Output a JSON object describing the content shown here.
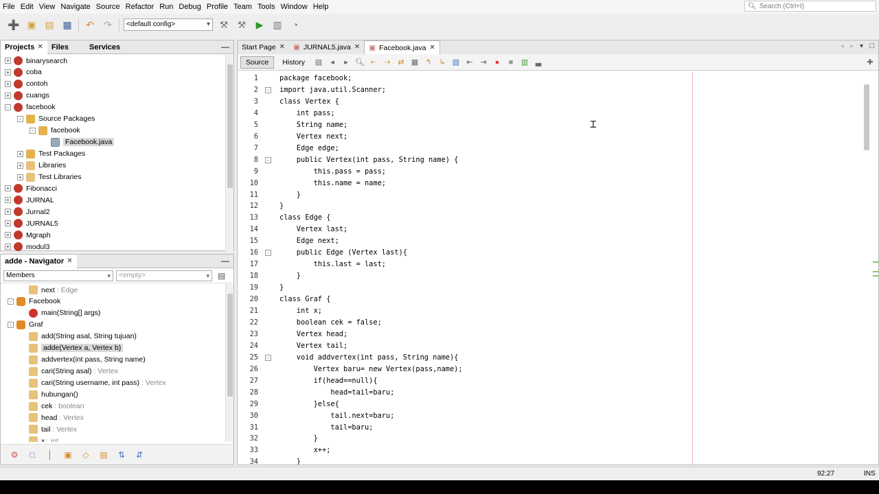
{
  "menubar": {
    "items": [
      "File",
      "Edit",
      "View",
      "Navigate",
      "Source",
      "Refactor",
      "Run",
      "Debug",
      "Profile",
      "Team",
      "Tools",
      "Window",
      "Help"
    ],
    "search_placeholder": "Search (Ctrl+I)"
  },
  "toolbar": {
    "config": "<default config>"
  },
  "projects_panel": {
    "tabs": [
      "Projects",
      "Files",
      "Services"
    ],
    "items": [
      {
        "label": "binarysearch",
        "level": 0,
        "type": "project",
        "expander": "+"
      },
      {
        "label": "coba",
        "level": 0,
        "type": "project",
        "expander": "+"
      },
      {
        "label": "contoh",
        "level": 0,
        "type": "project",
        "expander": "+"
      },
      {
        "label": "cuangs",
        "level": 0,
        "type": "project",
        "expander": "+"
      },
      {
        "label": "facebook",
        "level": 0,
        "type": "project",
        "expander": "-"
      },
      {
        "label": "Source Packages",
        "level": 1,
        "type": "pkg",
        "expander": "-"
      },
      {
        "label": "facebook",
        "level": 2,
        "type": "pkg",
        "expander": "-"
      },
      {
        "label": "Facebook.java",
        "level": 3,
        "type": "file",
        "expander": "",
        "selected": true
      },
      {
        "label": "Test Packages",
        "level": 1,
        "type": "pkg",
        "expander": "+"
      },
      {
        "label": "Libraries",
        "level": 1,
        "type": "lib",
        "expander": "+"
      },
      {
        "label": "Test Libraries",
        "level": 1,
        "type": "lib",
        "expander": "+"
      },
      {
        "label": "Fibonacci",
        "level": 0,
        "type": "project",
        "expander": "+"
      },
      {
        "label": "JURNAL",
        "level": 0,
        "type": "project",
        "expander": "+"
      },
      {
        "label": "Jurnal2",
        "level": 0,
        "type": "project",
        "expander": "+"
      },
      {
        "label": "JURNAL5",
        "level": 0,
        "type": "project",
        "expander": "+"
      },
      {
        "label": "Mgraph",
        "level": 0,
        "type": "project",
        "expander": "+"
      },
      {
        "label": "modul3",
        "level": 0,
        "type": "project",
        "expander": "+"
      }
    ]
  },
  "navigator_panel": {
    "title": "adde - Navigator",
    "filter_members": "Members",
    "filter_empty": "<empty>",
    "items": [
      {
        "label": "next",
        "type_suffix": " : Edge",
        "level": 2,
        "type": "field"
      },
      {
        "label": "Facebook",
        "type_suffix": "",
        "level": 1,
        "type": "class",
        "expander": "-"
      },
      {
        "label": "main(String[] args)",
        "type_suffix": "",
        "level": 2,
        "type": "method"
      },
      {
        "label": "Graf",
        "type_suffix": "",
        "level": 1,
        "type": "class",
        "expander": "-"
      },
      {
        "label": "add(String asal, String tujuan)",
        "type_suffix": "",
        "level": 2,
        "type": "field"
      },
      {
        "label": "adde(Vertex a, Vertex b)",
        "type_suffix": "",
        "level": 2,
        "type": "field",
        "selected": true
      },
      {
        "label": "addvertex(int pass, String name)",
        "type_suffix": "",
        "level": 2,
        "type": "field"
      },
      {
        "label": "cari(String asal)",
        "type_suffix": " : Vertex",
        "level": 2,
        "type": "field"
      },
      {
        "label": "cari(String username, int pass)",
        "type_suffix": " : Vertex",
        "level": 2,
        "type": "field"
      },
      {
        "label": "hubungan()",
        "type_suffix": "",
        "level": 2,
        "type": "field"
      },
      {
        "label": "cek",
        "type_suffix": " : boolean",
        "level": 2,
        "type": "field"
      },
      {
        "label": "head",
        "type_suffix": " : Vertex",
        "level": 2,
        "type": "field"
      },
      {
        "label": "tail",
        "type_suffix": " : Vertex",
        "level": 2,
        "type": "field"
      },
      {
        "label": "x",
        "type_suffix": " : int",
        "level": 2,
        "type": "field"
      }
    ]
  },
  "editor": {
    "tabs": [
      "Start Page",
      "JURNAL5.java",
      "Facebook.java"
    ],
    "active_tab": "Facebook.java",
    "source_label": "Source",
    "history_label": "History",
    "lines": [
      {
        "n": "1",
        "text": "package facebook;",
        "fold": ""
      },
      {
        "n": "2",
        "text": "import java.util.Scanner;",
        "fold": "-"
      },
      {
        "n": "3",
        "text": "class Vertex {",
        "fold": ""
      },
      {
        "n": "4",
        "text": "    int pass;",
        "fold": ""
      },
      {
        "n": "5",
        "text": "    String name;",
        "fold": ""
      },
      {
        "n": "6",
        "text": "    Vertex next;",
        "fold": ""
      },
      {
        "n": "7",
        "text": "    Edge edge;",
        "fold": ""
      },
      {
        "n": "8",
        "text": "    public Vertex(int pass, String name) {",
        "fold": "-"
      },
      {
        "n": "9",
        "text": "        this.pass = pass;",
        "fold": ""
      },
      {
        "n": "10",
        "text": "        this.name = name;",
        "fold": ""
      },
      {
        "n": "11",
        "text": "    }",
        "fold": ""
      },
      {
        "n": "12",
        "text": "}",
        "fold": ""
      },
      {
        "n": "13",
        "text": "class Edge {",
        "fold": ""
      },
      {
        "n": "14",
        "text": "    Vertex last;",
        "fold": ""
      },
      {
        "n": "15",
        "text": "    Edge next;",
        "fold": ""
      },
      {
        "n": "16",
        "text": "    public Edge (Vertex last){",
        "fold": "-"
      },
      {
        "n": "17",
        "text": "        this.last = last;",
        "fold": ""
      },
      {
        "n": "18",
        "text": "    }",
        "fold": ""
      },
      {
        "n": "19",
        "text": "}",
        "fold": ""
      },
      {
        "n": "20",
        "text": "class Graf {",
        "fold": ""
      },
      {
        "n": "21",
        "text": "    int x;",
        "fold": ""
      },
      {
        "n": "22",
        "text": "    boolean cek = false;",
        "fold": ""
      },
      {
        "n": "23",
        "text": "    Vertex head;",
        "fold": ""
      },
      {
        "n": "24",
        "text": "    Vertex tail;",
        "fold": ""
      },
      {
        "n": "25",
        "text": "    void addvertex(int pass, String name){",
        "fold": "-"
      },
      {
        "n": "26",
        "text": "        Vertex baru= new Vertex(pass,name);",
        "fold": ""
      },
      {
        "n": "27",
        "text": "        if(head==null){",
        "fold": ""
      },
      {
        "n": "28",
        "text": "            head=tail=baru;",
        "fold": ""
      },
      {
        "n": "29",
        "text": "        }else{",
        "fold": ""
      },
      {
        "n": "30",
        "text": "            tail.next=baru;",
        "fold": ""
      },
      {
        "n": "31",
        "text": "            tail=baru;",
        "fold": ""
      },
      {
        "n": "32",
        "text": "        }",
        "fold": ""
      },
      {
        "n": "33",
        "text": "        x++;",
        "fold": ""
      },
      {
        "n": "34",
        "text": "    }",
        "fold": ""
      }
    ]
  },
  "status": {
    "position": "92:27",
    "mode": "INS"
  }
}
